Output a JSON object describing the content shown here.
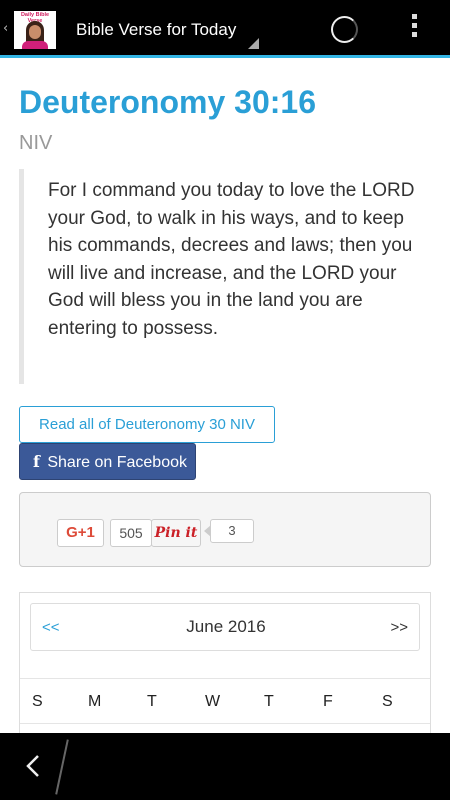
{
  "app": {
    "title": "Bible Verse for Today",
    "logo_text": "Daily Bible Verse",
    "back_glyph": "‹"
  },
  "verse": {
    "reference": "Deuteronomy 30:16",
    "version": "NIV",
    "text": "For I command you today to love the LORD your God, to walk in his ways, and to keep his commands, decrees and laws; then you will live and increase, and the LORD your God will bless you in the land you are entering to possess."
  },
  "buttons": {
    "read_all": "Read all of Deuteronomy 30 NIV",
    "facebook_icon": "f",
    "share_facebook": "Share on Facebook"
  },
  "social": {
    "gplus_label": "G+1",
    "gplus_count": "505",
    "pinterest_label": "Pin it",
    "pinterest_count": "3"
  },
  "calendar": {
    "prev": "<<",
    "month": "June 2016",
    "next": ">>",
    "weekdays": [
      "S",
      "M",
      "T",
      "W",
      "T",
      "F",
      "S"
    ]
  },
  "colors": {
    "accent": "#2a9fd6",
    "actionbar_underline": "#33b5e5",
    "facebook": "#3b5998",
    "gplus": "#dd4b39",
    "pinterest": "#cb2027"
  },
  "icons": [
    "spinner-icon",
    "overflow-menu-icon",
    "back-arrow-icon",
    "facebook-icon"
  ]
}
